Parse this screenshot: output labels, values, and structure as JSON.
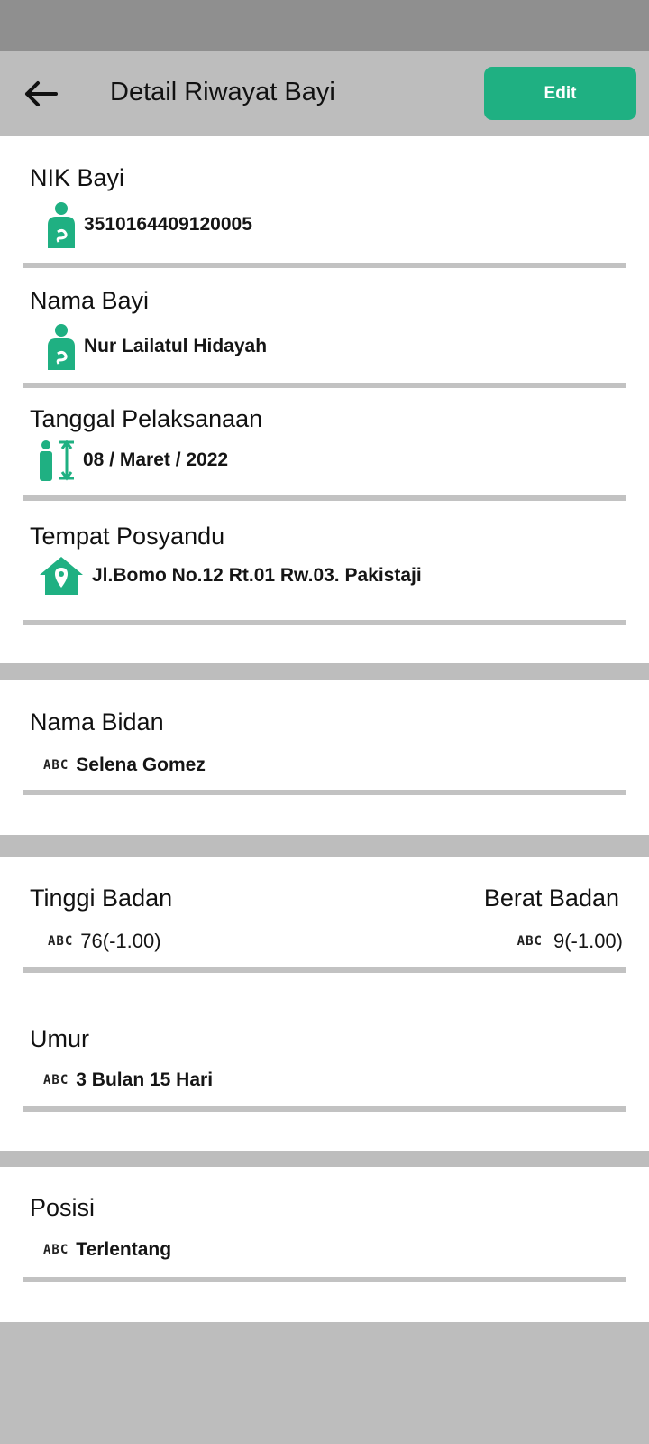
{
  "app": {
    "title": "Detail Riwayat Bayi",
    "edit_label": "Edit",
    "accent": "#1fb082"
  },
  "fields": {
    "nik": {
      "label": "NIK Bayi",
      "value": "3510164409120005",
      "icon": "mother-baby-icon"
    },
    "nama": {
      "label": "Nama Bayi",
      "value": "Nur Lailatul Hidayah",
      "icon": "mother-baby-icon"
    },
    "tanggal": {
      "label": "Tanggal Pelaksanaan",
      "value": "08 / Maret / 2022",
      "icon": "height-measure-icon"
    },
    "tempat": {
      "label": "Tempat Posyandu",
      "value": "Jl.Bomo No.12 Rt.01 Rw.03. Pakistaji",
      "icon": "home-location-icon"
    },
    "bidan": {
      "label": "Nama Bidan",
      "value": "Selena Gomez",
      "icon": "abc-icon"
    },
    "tinggi": {
      "label": "Tinggi Badan",
      "value": "76(-1.00)",
      "icon": "abc-icon"
    },
    "berat": {
      "label": "Berat Badan",
      "value": "9(-1.00)",
      "icon": "abc-icon"
    },
    "umur": {
      "label": "Umur",
      "value": "3 Bulan 15 Hari",
      "icon": "abc-icon"
    },
    "posisi": {
      "label": "Posisi",
      "value": "Terlentang",
      "icon": "abc-icon"
    }
  },
  "abc_text": "ABC"
}
